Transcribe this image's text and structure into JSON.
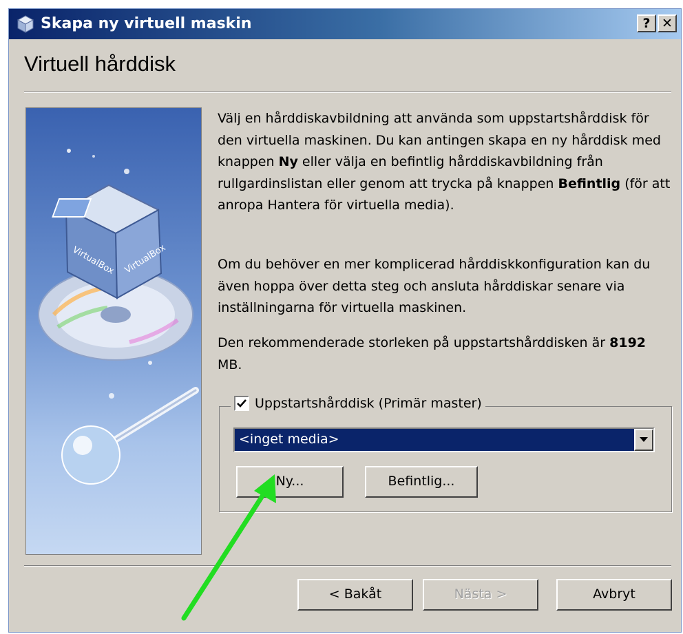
{
  "window": {
    "title": "Skapa ny virtuell maskin",
    "help_label": "?",
    "close_label": "✕",
    "icon": "virtualbox-cube-icon"
  },
  "page": {
    "title": "Virtuell hårddisk"
  },
  "description": {
    "p1_a": "Välj en hårddiskavbildning att använda som uppstartshårddisk för den virtuella maskinen. Du kan antingen skapa en ny hårddisk med knappen ",
    "p1_b": "Ny",
    "p1_c": " eller välja en befintlig hårddiskavbildning från rullgardinslistan eller genom att trycka på knappen ",
    "p1_d": "Befintlig",
    "p1_e": " (för att anropa Hantera för virtuella media).",
    "p2": "Om du behöver en mer komplicerad hårddiskkonfiguration kan du även hoppa över detta steg och ansluta hårddiskar senare via inställningarna för virtuella maskinen.",
    "p3_a": "Den rekommenderade storleken på uppstartshårddisken är ",
    "p3_size": "8192",
    "p3_unit": " MB."
  },
  "boot_disk": {
    "checkbox_label": "Uppstartshårddisk (Primär master)",
    "checked": true,
    "selected_media": "<inget media>",
    "new_button": "Ny...",
    "existing_button": "Befintlig..."
  },
  "footer": {
    "back_button": "< Bakåt",
    "next_button": "Nästa >",
    "cancel_button": "Avbryt"
  },
  "colors": {
    "title_bar_start": "#0a246a",
    "title_bar_end": "#a6caf0",
    "dialog_bg": "#d4d0c8",
    "selection_bg": "#0a246a",
    "annotation_arrow": "#22dd22"
  },
  "annotation": {
    "icon": "green-arrow-icon"
  }
}
